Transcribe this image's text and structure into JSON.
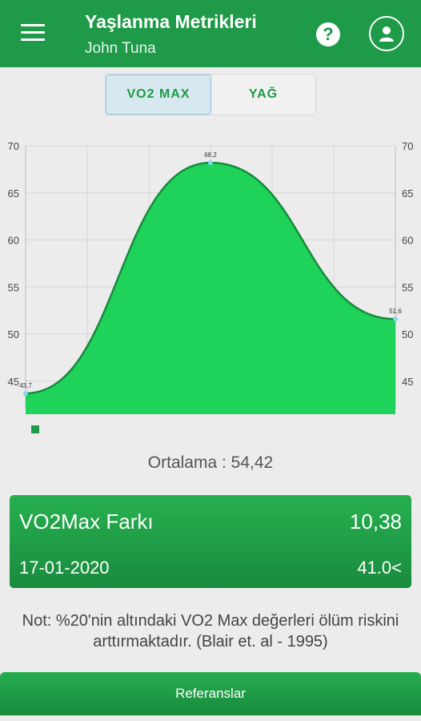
{
  "appbar": {
    "title": "Yaşlanma Metrikleri",
    "subtitle": "John Tuna",
    "menu_icon": "hamburger-menu-icon",
    "help_icon": "question-icon",
    "profile_icon": "person-icon"
  },
  "tabs": [
    {
      "label": "VO2 MAX",
      "active": true
    },
    {
      "label": "YAĞ",
      "active": false
    }
  ],
  "chart_data": {
    "type": "area",
    "x": [
      0,
      1,
      2
    ],
    "values": [
      43.7,
      68.2,
      51.6
    ],
    "data_labels": [
      "43,7",
      "68,2",
      "51,6"
    ],
    "y_ticks": [
      45,
      50,
      55,
      60,
      65,
      70
    ],
    "ylim": [
      42,
      70
    ],
    "grid": true,
    "fill_color": "#1fd35a",
    "line_color": "#178a3d",
    "point_color": "#7fd7f0"
  },
  "summary": {
    "average": "Ortalama : 54,42"
  },
  "card": {
    "title": "VO2Max Farkı",
    "value": "10,38",
    "date": "17-01-2020",
    "threshold": "41.0<"
  },
  "note": "Not: %20'nin altındaki VO2 Max değerleri ölüm riskini arttırmaktadır. (Blair et. al - 1995)",
  "reference_button": "Referanslar",
  "colors": {
    "primary": "#1e9a48",
    "background": "#ececec"
  }
}
